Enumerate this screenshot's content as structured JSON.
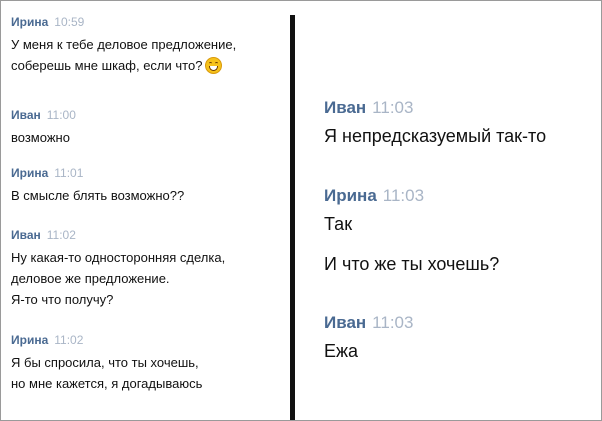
{
  "left": {
    "messages": [
      {
        "author": "Ирина",
        "time": "10:59",
        "lines": [
          "У меня к тебе деловое предложение,",
          "соберешь мне шкаф, если что?"
        ],
        "emoji": "grinning-face-emoji"
      },
      {
        "author": "Иван",
        "time": "11:00",
        "lines": [
          "возможно"
        ]
      },
      {
        "author": "Ирина",
        "time": "11:01",
        "lines": [
          "В смысле блять возможно??"
        ]
      },
      {
        "author": "Иван",
        "time": "11:02",
        "lines": [
          "Ну какая-то односторонняя сделка,",
          "деловое же предложение.",
          "Я-то что получу?"
        ]
      },
      {
        "author": "Ирина",
        "time": "11:02",
        "lines": [
          "Я бы спросила, что ты хочешь,",
          "но мне кажется, я догадываюсь"
        ]
      }
    ]
  },
  "right": {
    "messages": [
      {
        "author": "Иван",
        "time": "11:03",
        "lines": [
          "Я непредсказуемый так-то"
        ]
      },
      {
        "author": "Ирина",
        "time": "11:03",
        "lines": [
          "Так",
          "И что же ты хочешь?"
        ]
      },
      {
        "author": "Иван",
        "time": "11:03",
        "lines": [
          "Ежа"
        ]
      }
    ]
  },
  "colors": {
    "author": "#4a6a92",
    "time": "#a9b5c6",
    "text": "#111111",
    "divider": "#111111"
  }
}
